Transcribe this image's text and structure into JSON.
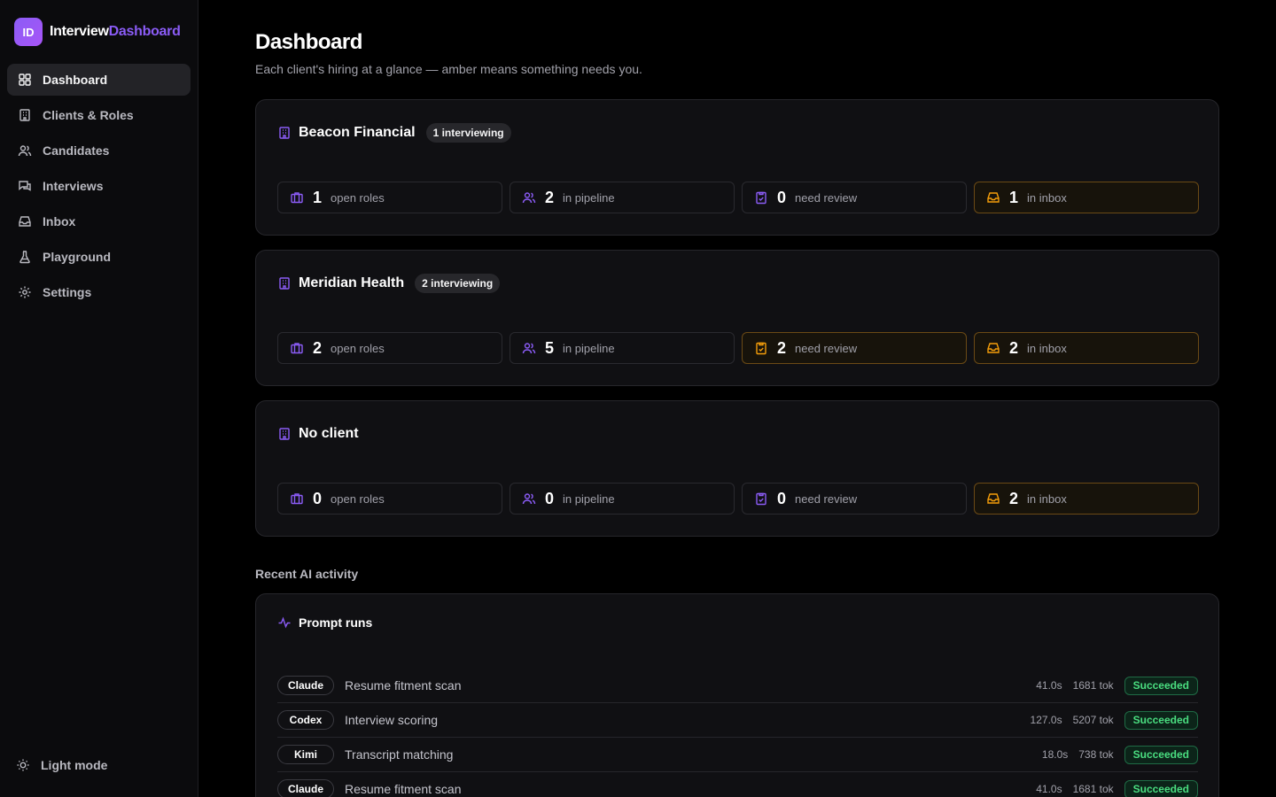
{
  "brand": {
    "logo_text": "ID",
    "name_part1": "Interview",
    "name_part2": "Dashboard"
  },
  "sidebar": {
    "items": [
      {
        "label": "Dashboard",
        "icon": "grid-icon",
        "active": true
      },
      {
        "label": "Clients & Roles",
        "icon": "building-icon"
      },
      {
        "label": "Candidates",
        "icon": "users-icon"
      },
      {
        "label": "Interviews",
        "icon": "messages-icon"
      },
      {
        "label": "Inbox",
        "icon": "inbox-icon"
      },
      {
        "label": "Playground",
        "icon": "flask-icon"
      },
      {
        "label": "Settings",
        "icon": "gear-icon"
      }
    ],
    "light_mode_label": "Light mode"
  },
  "header": {
    "title": "Dashboard",
    "subtitle": "Each client's hiring at a glance — amber means something needs you."
  },
  "clients": [
    {
      "name": "Beacon Financial",
      "badge": "1 interviewing",
      "stats": [
        {
          "value": "1",
          "label": "open roles",
          "alert": false
        },
        {
          "value": "2",
          "label": "in pipeline",
          "alert": false
        },
        {
          "value": "0",
          "label": "need review",
          "alert": false
        },
        {
          "value": "1",
          "label": "in inbox",
          "alert": true
        }
      ]
    },
    {
      "name": "Meridian Health",
      "badge": "2 interviewing",
      "stats": [
        {
          "value": "2",
          "label": "open roles",
          "alert": false
        },
        {
          "value": "5",
          "label": "in pipeline",
          "alert": false
        },
        {
          "value": "2",
          "label": "need review",
          "alert": true
        },
        {
          "value": "2",
          "label": "in inbox",
          "alert": true
        }
      ]
    },
    {
      "name": "No client",
      "badge": "",
      "stats": [
        {
          "value": "0",
          "label": "open roles",
          "alert": false
        },
        {
          "value": "0",
          "label": "in pipeline",
          "alert": false
        },
        {
          "value": "0",
          "label": "need review",
          "alert": false
        },
        {
          "value": "2",
          "label": "in inbox",
          "alert": true
        }
      ]
    }
  ],
  "activity": {
    "section_label": "Recent AI activity",
    "card_title": "Prompt runs",
    "runs": [
      {
        "model": "Claude",
        "name": "Resume fitment scan",
        "duration": "41.0s",
        "tokens": "1681 tok",
        "status": "Succeeded"
      },
      {
        "model": "Codex",
        "name": "Interview scoring",
        "duration": "127.0s",
        "tokens": "5207 tok",
        "status": "Succeeded"
      },
      {
        "model": "Kimi",
        "name": "Transcript matching",
        "duration": "18.0s",
        "tokens": "738 tok",
        "status": "Succeeded"
      },
      {
        "model": "Claude",
        "name": "Resume fitment scan",
        "duration": "41.0s",
        "tokens": "1681 tok",
        "status": "Succeeded"
      }
    ]
  },
  "colors": {
    "accent": "#8b5cf6",
    "amber": "#f59e0b",
    "success": "#4ade80",
    "background": "#000000"
  }
}
